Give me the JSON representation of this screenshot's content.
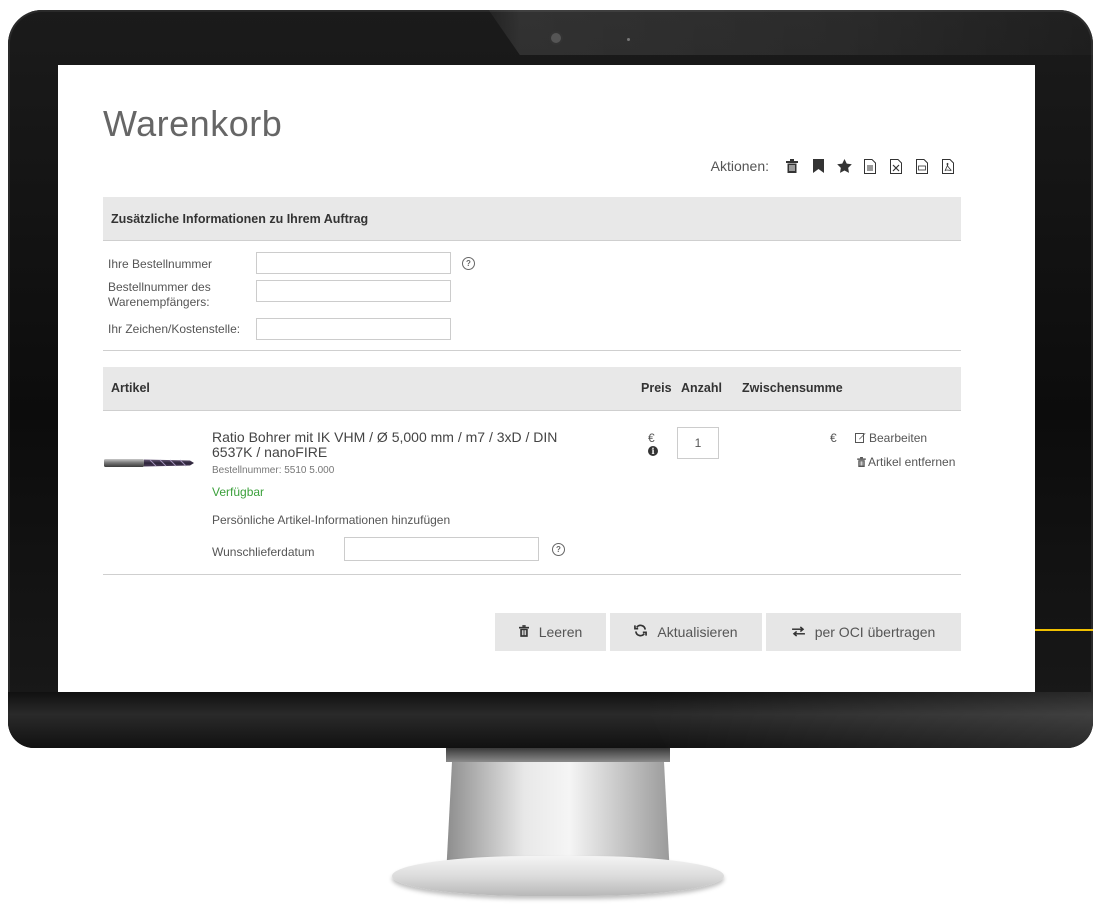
{
  "page": {
    "title": "Warenkorb",
    "actions_label": "Aktionen:",
    "action_icons": [
      "trash-icon",
      "bookmark-icon",
      "star-icon",
      "document-icon",
      "excel-icon",
      "csv-icon",
      "pdf-icon"
    ]
  },
  "order_info": {
    "header": "Zusätzliche Informationen zu Ihrem Auftrag",
    "fields": [
      {
        "label": "Ihre Bestellnummer",
        "value": ""
      },
      {
        "label": "Bestellnummer des Warenempfängers:",
        "value": ""
      },
      {
        "label": "Ihr Zeichen/Kostenstelle:",
        "value": ""
      }
    ]
  },
  "table": {
    "columns": [
      "Artikel",
      "Preis",
      "Anzahl",
      "Zwischensumme"
    ]
  },
  "item": {
    "name": "Ratio Bohrer mit IK VHM / Ø 5,000 mm / m7 / 3xD / DIN 6537K / nanoFIRE",
    "order_number": "Bestellnummer: 5510 5.000",
    "availability": "Verfügbar",
    "add_info_link": "Persönliche Artikel-Informationen hinzufügen",
    "delivery_date_label": "Wunschlieferdatum",
    "delivery_date_value": "",
    "price_currency": "€",
    "quantity": "1",
    "subtotal_currency": "€",
    "edit_label": "Bearbeiten",
    "remove_label": "Artikel entfernen"
  },
  "buttons": {
    "clear": "Leeren",
    "update": "Aktualisieren",
    "transfer": "per OCI übertragen"
  },
  "colors": {
    "available": "#3ba03b",
    "header_bg": "#e8e8e8",
    "button_bg": "#e6e6e6",
    "callout": "#f0c000"
  }
}
